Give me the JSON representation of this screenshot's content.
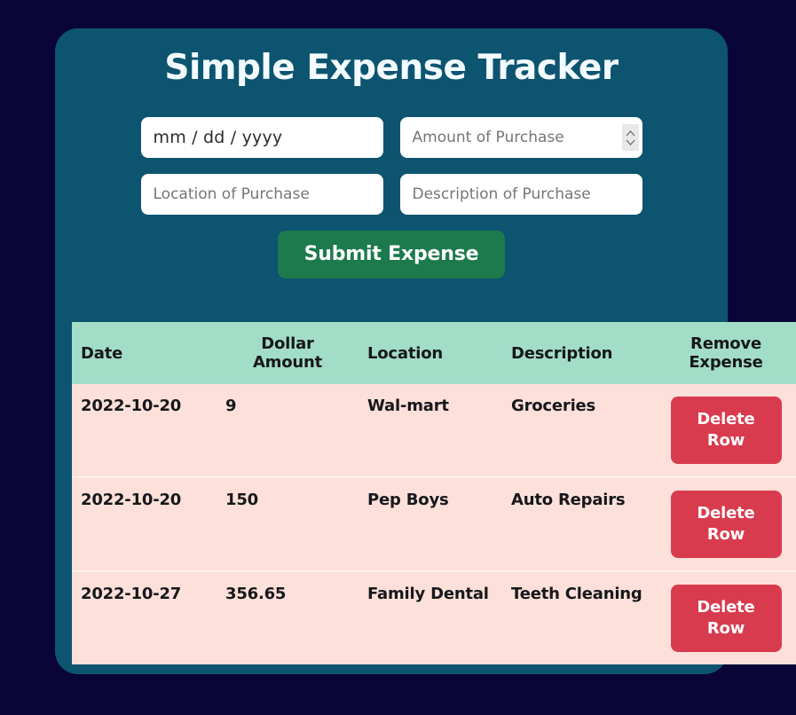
{
  "app": {
    "title": "Simple Expense Tracker",
    "background_color": "#0a0538",
    "card_color": "#0d5470",
    "accent_green": "#1c7a4c",
    "accent_red": "#d93b4e",
    "header_mint": "#a2ddc8",
    "row_pink": "#fce0d9"
  },
  "form": {
    "date_field": {
      "value": "mm / dd / yyyy",
      "placeholder": "mm/dd/yyyy"
    },
    "amount_field": {
      "value": "",
      "placeholder": "Amount of Purchase",
      "spinner_icon": "stepper-up-down-icon"
    },
    "location_field": {
      "value": "",
      "placeholder": "Location of Purchase"
    },
    "description_field": {
      "value": "",
      "placeholder": "Description of Purchase"
    },
    "submit_label": "Submit Expense"
  },
  "table": {
    "headers": {
      "date": "Date",
      "amount_line1": "Dollar",
      "amount_line2": "Amount",
      "location": "Location",
      "description": "Description",
      "remove_line1": "Remove",
      "remove_line2": "Expense"
    },
    "delete_button": {
      "line1": "Delete",
      "line2": "Row"
    },
    "rows": [
      {
        "date": "2022-10-20",
        "amount": "9",
        "location": "Wal-mart",
        "description": "Groceries"
      },
      {
        "date": "2022-10-20",
        "amount": "150",
        "location": "Pep Boys",
        "description": "Auto Repairs"
      },
      {
        "date": "2022-10-27",
        "amount": "356.65",
        "location": "Family Dental",
        "description": "Teeth Cleaning"
      }
    ]
  }
}
